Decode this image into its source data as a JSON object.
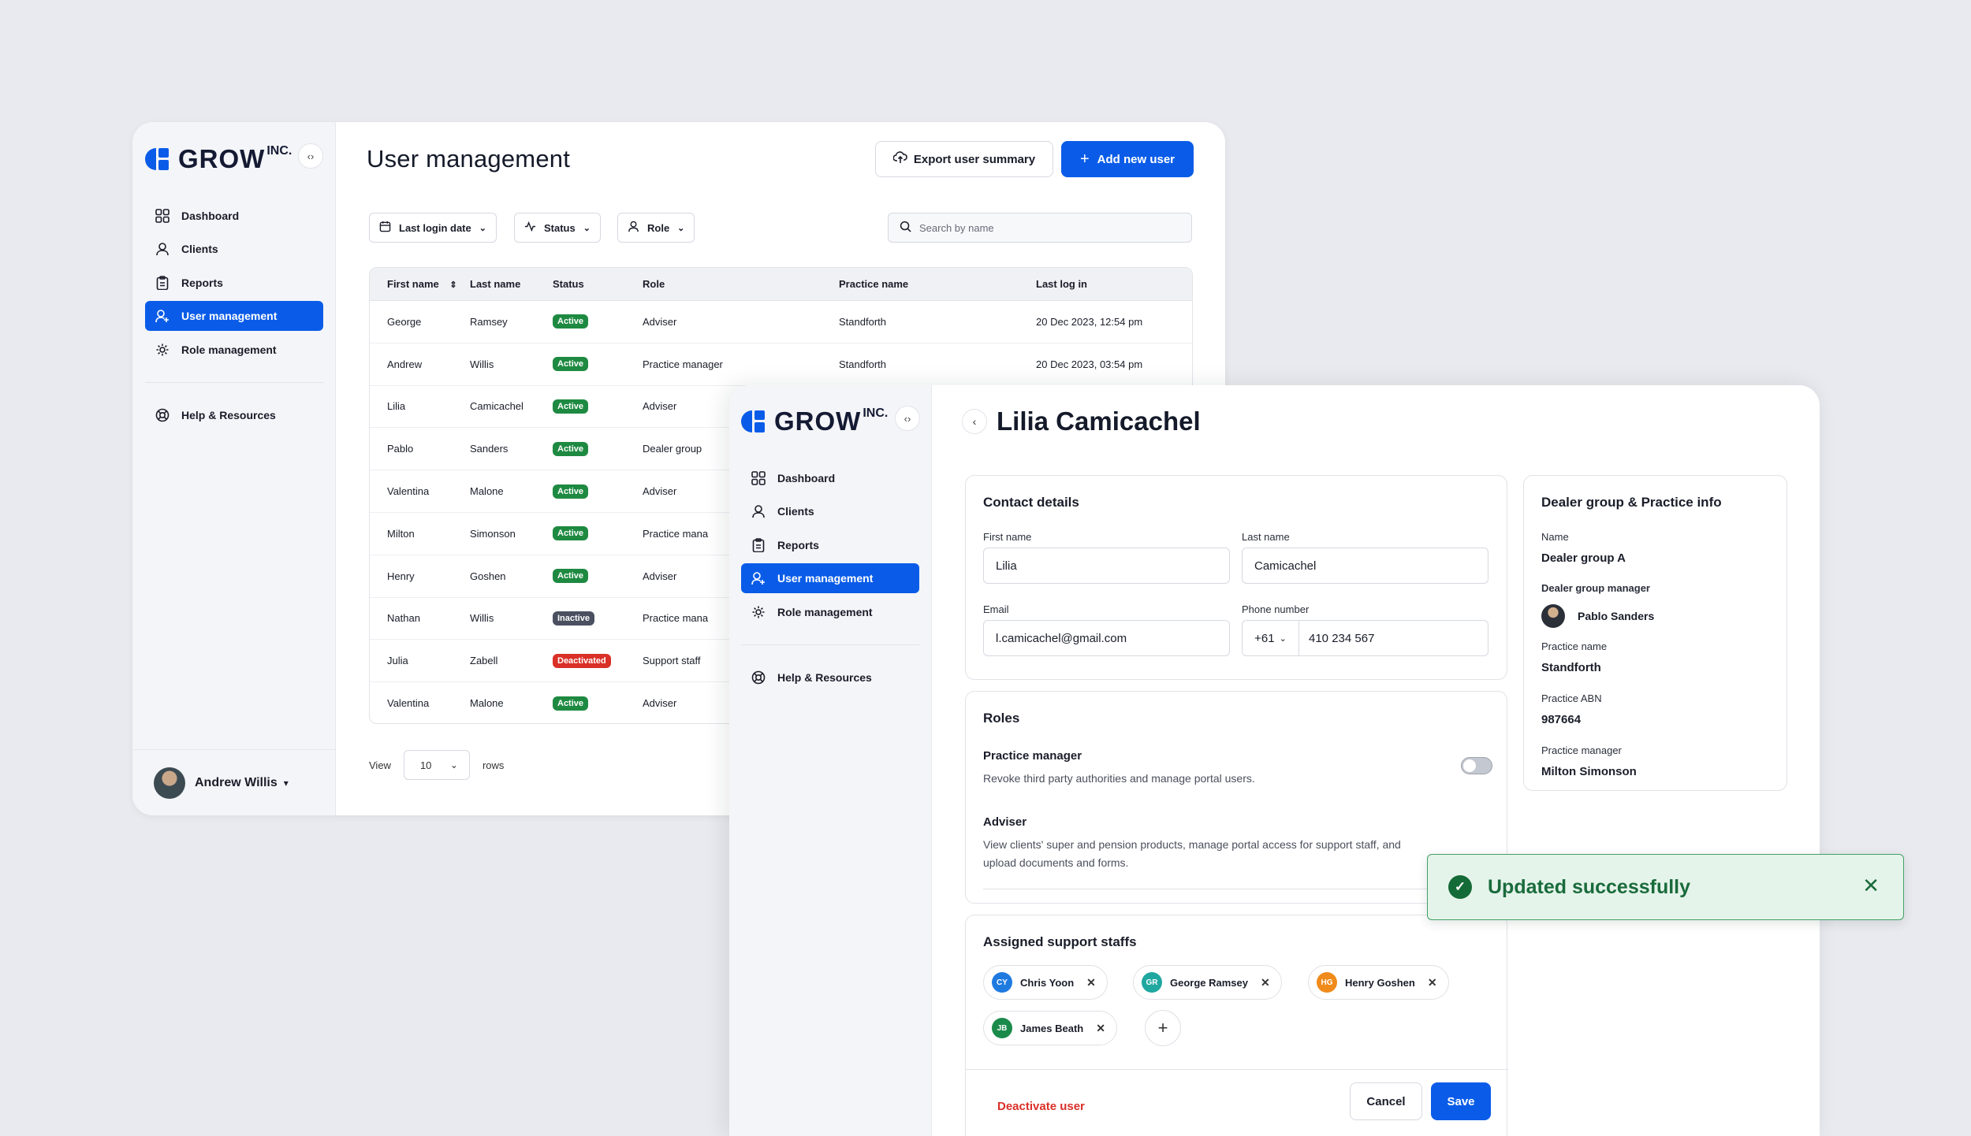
{
  "brand": {
    "name": "GROW",
    "suffix": "INC."
  },
  "colors": {
    "primary": "#0a5ce8",
    "active": "#1e8a41",
    "inactive": "#4a5060",
    "deactivated": "#d93027",
    "success": "#146b37"
  },
  "nav": {
    "items": [
      {
        "label": "Dashboard",
        "icon": "grid-icon"
      },
      {
        "label": "Clients",
        "icon": "users-icon"
      },
      {
        "label": "Reports",
        "icon": "clipboard-icon"
      },
      {
        "label": "User management",
        "icon": "user-add-icon"
      },
      {
        "label": "Role management",
        "icon": "gear-icon"
      }
    ],
    "help": "Help & Resources"
  },
  "current_user": {
    "name": "Andrew Willis"
  },
  "users_page": {
    "title": "User management",
    "export_label": "Export user summary",
    "add_label": "Add new user",
    "filters": {
      "last_login": "Last login date",
      "status": "Status",
      "role": "Role"
    },
    "search_placeholder": "Search by name",
    "columns": [
      "First name",
      "Last name",
      "Status",
      "Role",
      "Practice name",
      "Last log in"
    ],
    "rows": [
      {
        "first": "George",
        "last": "Ramsey",
        "status": "Active",
        "role": "Adviser",
        "practice": "Standforth",
        "login": "20 Dec 2023, 12:54 pm"
      },
      {
        "first": "Andrew",
        "last": "Willis",
        "status": "Active",
        "role": "Practice manager",
        "practice": "Standforth",
        "login": "20 Dec 2023, 03:54 pm"
      },
      {
        "first": "Lilia",
        "last": "Camicachel",
        "status": "Active",
        "role": "Adviser",
        "practice": "",
        "login": ""
      },
      {
        "first": "Pablo",
        "last": "Sanders",
        "status": "Active",
        "role": "Dealer group",
        "practice": "",
        "login": ""
      },
      {
        "first": "Valentina",
        "last": "Malone",
        "status": "Active",
        "role": "Adviser",
        "practice": "",
        "login": ""
      },
      {
        "first": "Milton",
        "last": "Simonson",
        "status": "Active",
        "role": "Practice mana",
        "practice": "",
        "login": ""
      },
      {
        "first": "Henry",
        "last": "Goshen",
        "status": "Active",
        "role": "Adviser",
        "practice": "",
        "login": ""
      },
      {
        "first": "Nathan",
        "last": "Willis",
        "status": "Inactive",
        "role": "Practice mana",
        "practice": "",
        "login": ""
      },
      {
        "first": "Julia",
        "last": "Zabell",
        "status": "Deactivated",
        "role": "Support staff",
        "practice": "",
        "login": ""
      },
      {
        "first": "Valentina",
        "last": "Malone",
        "status": "Active",
        "role": "Adviser",
        "practice": "",
        "login": ""
      }
    ],
    "pager": {
      "view": "View",
      "size": "10",
      "rows": "rows"
    }
  },
  "detail": {
    "name": "Lilia Camicachel",
    "contact": {
      "title": "Contact details",
      "first_label": "First name",
      "first": "Lilia",
      "last_label": "Last name",
      "last": "Camicachel",
      "email_label": "Email",
      "email": "l.camicachel@gmail.com",
      "phone_label": "Phone number",
      "phone_code": "+61",
      "phone": "410 234 567"
    },
    "roles": {
      "title": "Roles",
      "items": [
        {
          "name": "Practice manager",
          "desc": "Revoke third party authorities and manage portal users.",
          "enabled": false
        },
        {
          "name": "Adviser",
          "desc": "View clients' super and pension products, manage portal access for support staff, and upload documents and forms."
        }
      ]
    },
    "support": {
      "title": "Assigned support staffs",
      "staff": [
        {
          "initials": "CY",
          "name": "Chris Yoon",
          "color": "#1f7ae0"
        },
        {
          "initials": "GR",
          "name": "George Ramsey",
          "color": "#20a7a0"
        },
        {
          "initials": "HG",
          "name": "Henry Goshen",
          "color": "#f08a1a"
        },
        {
          "initials": "JB",
          "name": "James Beath",
          "color": "#1a8a4a"
        }
      ]
    },
    "actions": {
      "deactivate": "Deactivate user",
      "cancel": "Cancel",
      "save": "Save"
    },
    "dealer": {
      "title": "Dealer group & Practice info",
      "name_label": "Name",
      "name": "Dealer group A",
      "manager_label": "Dealer group manager",
      "manager": "Pablo Sanders",
      "practice_label": "Practice name",
      "practice": "Standforth",
      "abn_label": "Practice ABN",
      "abn": "987664",
      "pm_label": "Practice manager",
      "pm": "Milton Simonson"
    }
  },
  "toast": {
    "message": "Updated successfully"
  }
}
